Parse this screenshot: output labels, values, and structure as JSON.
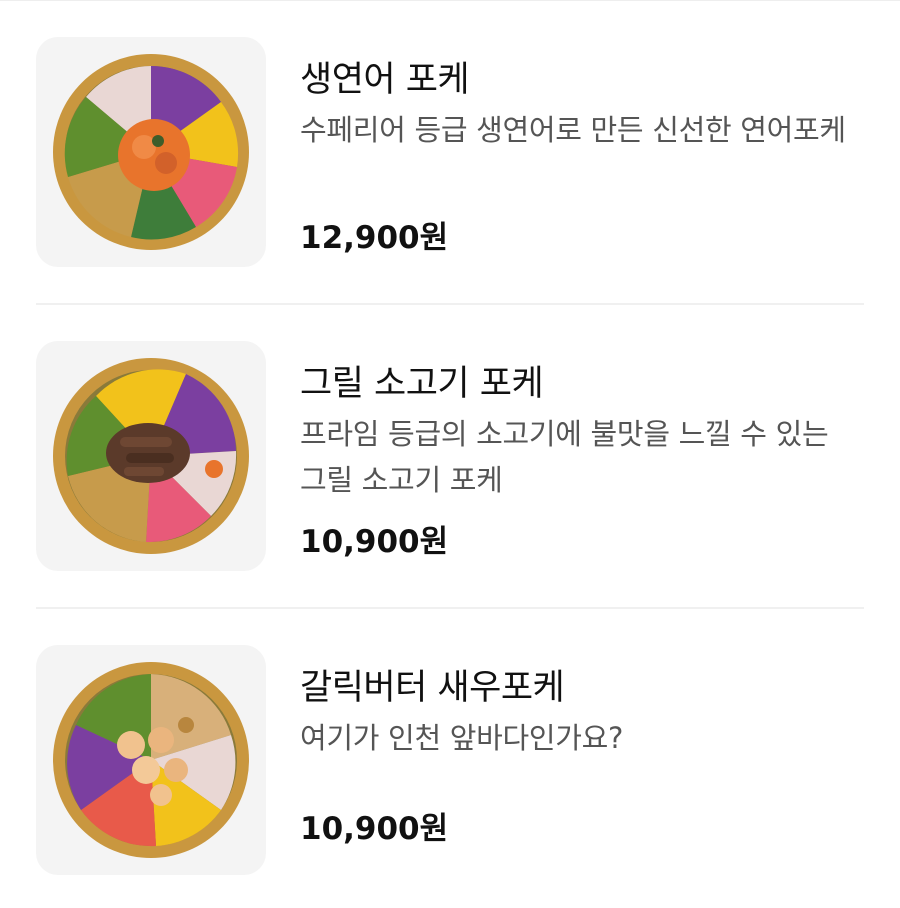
{
  "menu": {
    "items": [
      {
        "name": "생연어 포케",
        "description": "수페리어 등급 생연어로 만든 신선한 연어포케",
        "price": "12,900원",
        "image_icon": "salmon-poke-bowl-image"
      },
      {
        "name": "그릴 소고기 포케",
        "description": "프라임 등급의 소고기에 불맛을 느낄 수 있는 그릴 소고기 포케",
        "price": "10,900원",
        "image_icon": "beef-poke-bowl-image"
      },
      {
        "name": "갈릭버터 새우포케",
        "description": "여기가 인천 앞바다인가요?",
        "price": "10,900원",
        "image_icon": "shrimp-poke-bowl-image"
      }
    ]
  },
  "colors": {
    "background": "#ffffff",
    "title": "#111111",
    "description": "#555555",
    "price": "#111111",
    "thumb_bg": "#f4f4f4",
    "divider": "#f0f0f0",
    "bowl": "#c9973f"
  }
}
